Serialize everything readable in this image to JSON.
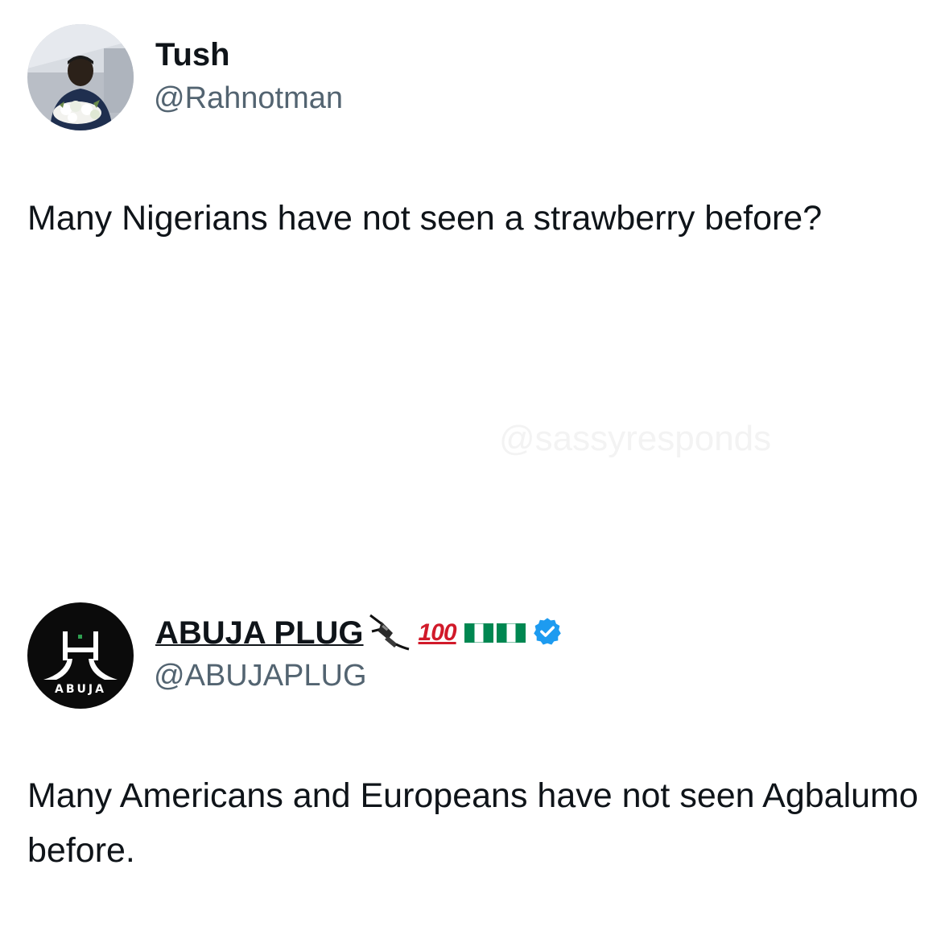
{
  "tweets": [
    {
      "display_name": "Tush",
      "handle": "@Rahnotman",
      "text": "Many Nigerians have not seen a strawberry before?"
    },
    {
      "display_name": "ABUJA PLUG",
      "handle": "@ABUJAPLUG",
      "name_emojis": [
        "electric-plug-icon",
        "hundred-points-icon",
        "nigeria-flag-icon"
      ],
      "hundred_label": "100",
      "verified": true,
      "avatar_label": "ABUJA",
      "text": "Many Americans and Europeans have not seen Agbalumo before."
    }
  ],
  "watermark": "@sassyresponds",
  "colors": {
    "text": "#0f1419",
    "handle": "#536471",
    "verified": "#1d9bf0",
    "flag_green": "#008751",
    "hundred_red": "#d11a2a"
  }
}
